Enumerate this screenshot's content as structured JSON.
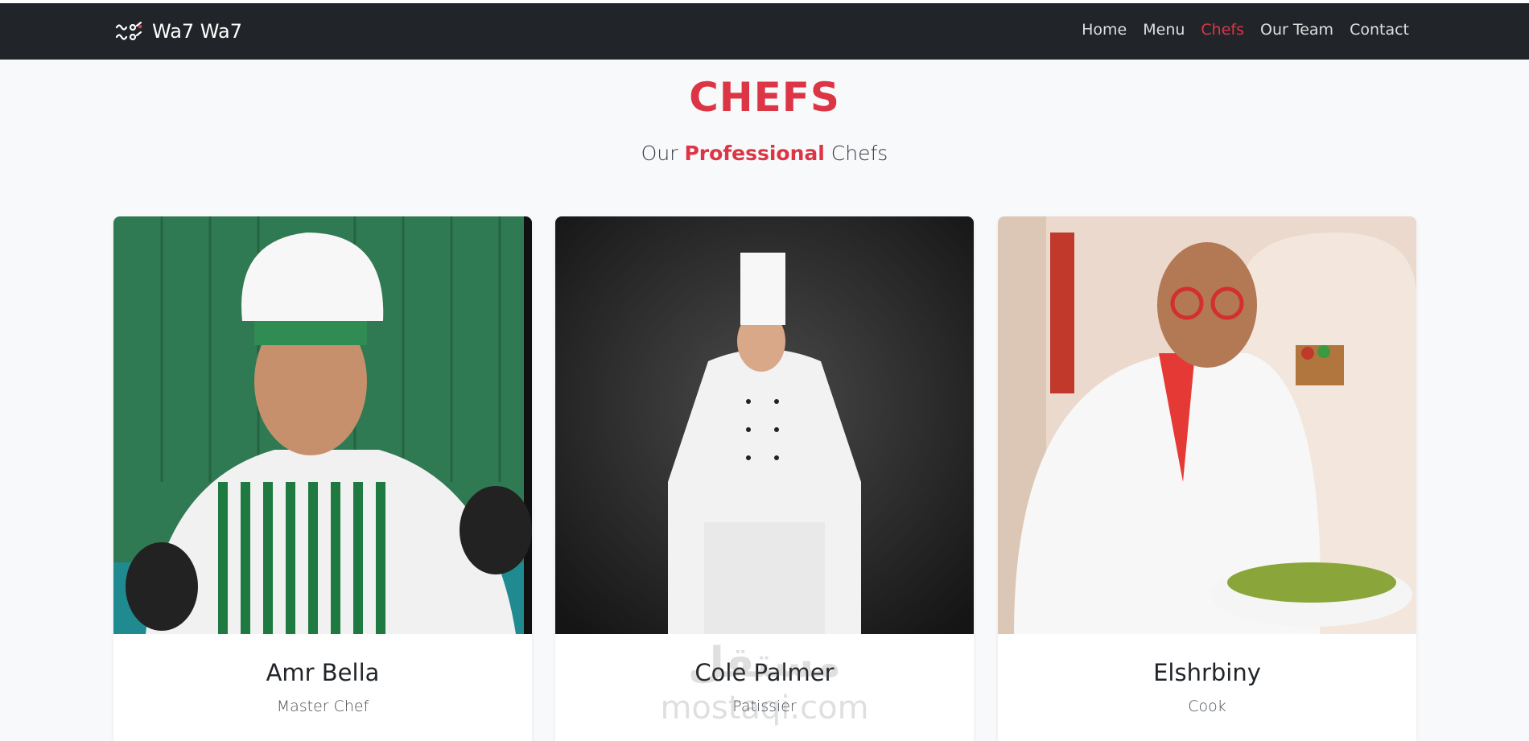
{
  "brand": {
    "name": "Wa7 Wa7",
    "logo_icon": "waw-logo-icon"
  },
  "nav": {
    "items": [
      {
        "label": "Home",
        "active": false
      },
      {
        "label": "Menu",
        "active": false
      },
      {
        "label": "Chefs",
        "active": true
      },
      {
        "label": "Our Team",
        "active": false
      },
      {
        "label": "Contact",
        "active": false
      }
    ]
  },
  "section": {
    "title": "CHEFS",
    "subtitle_prefix": "Our",
    "subtitle_highlight": "Professional",
    "subtitle_suffix": "Chefs"
  },
  "chefs": [
    {
      "name": "Amr Bella",
      "role": "Master Chef"
    },
    {
      "name": "Cole Palmer",
      "role": "Patissier"
    },
    {
      "name": "Elshrbiny",
      "role": "Cook"
    }
  ],
  "watermark": {
    "text_latin": "mostaqi.com",
    "text_arabic": "مستقل"
  },
  "colors": {
    "accent": "#dc3545",
    "navbar": "#212529",
    "background": "#f8f9fa"
  }
}
